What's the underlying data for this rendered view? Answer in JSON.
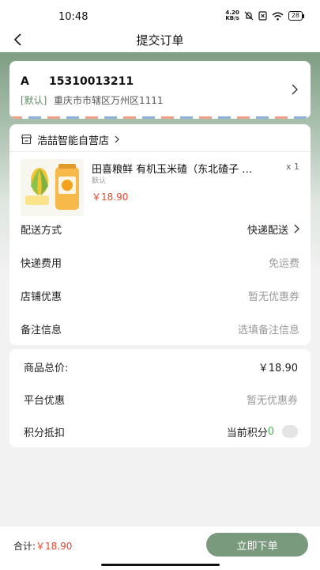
{
  "status_bar": {
    "time": "10:48",
    "net_speed_top": "4.20",
    "net_speed_bottom": "KB/s",
    "battery": "28",
    "icons": [
      "mute-bell-icon",
      "sim-x-icon",
      "wifi-icon",
      "battery-icon"
    ]
  },
  "nav": {
    "title": "提交订单",
    "back_icon": "chevron-left-icon"
  },
  "address": {
    "name": "A",
    "phone": "15310013211",
    "default_tag": "[默认]",
    "detail": "重庆市市辖区万州区1111"
  },
  "shop": {
    "name": "浩喆智能自营店",
    "product": {
      "title": "田喜粮鲜 有机玉米碴（东北碴子 …",
      "quantity": "x 1",
      "spec": "默认",
      "price": "￥18.90"
    },
    "rows": {
      "delivery_label": "配送方式",
      "delivery_value": "快递配送",
      "shipping_label": "快递费用",
      "shipping_value": "免运费",
      "store_discount_label": "店铺优惠",
      "store_discount_value": "暂无优惠券",
      "note_label": "备注信息",
      "note_placeholder": "选填备注信息"
    }
  },
  "summary": {
    "goods_total_label": "商品总价:",
    "goods_total_value": "￥18.90",
    "platform_discount_label": "平台优惠",
    "platform_discount_value": "暂无优惠券",
    "points_label": "积分抵扣",
    "points_prefix": "当前积分",
    "points_value": "0",
    "points_toggle_on": false
  },
  "bottom": {
    "total_label": "合计:",
    "total_value": "￥18.90",
    "submit_label": "立即下单"
  },
  "colors": {
    "header_green": "#7e9e83",
    "button_green": "#7a9a7e",
    "price_red": "#e04a2f",
    "default_tag_green": "#5f8a66",
    "points_green": "#4caf50"
  }
}
